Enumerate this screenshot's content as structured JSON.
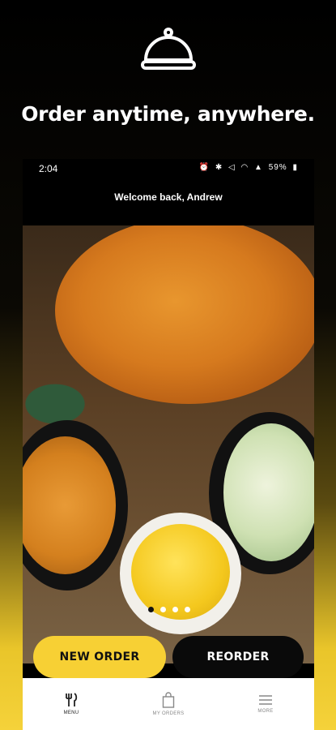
{
  "promo": {
    "icon": "cloche-icon",
    "title": "Order anytime, anywhere."
  },
  "status_bar": {
    "time": "2:04",
    "battery": "59%"
  },
  "header": {
    "welcome": "Welcome back, Andrew"
  },
  "carousel": {
    "slides": 4,
    "active_index": 0
  },
  "actions": {
    "new_order": "NEW ORDER",
    "reorder": "REORDER"
  },
  "bottom_nav": {
    "items": [
      {
        "label": "MENU",
        "icon": "fork-knife-icon",
        "active": true
      },
      {
        "label": "MY ORDERS",
        "icon": "bag-icon",
        "active": false
      },
      {
        "label": "MORE",
        "icon": "hamburger-icon",
        "active": false
      }
    ]
  },
  "colors": {
    "accent_yellow": "#f7d034",
    "dark": "#0a0a0a"
  }
}
